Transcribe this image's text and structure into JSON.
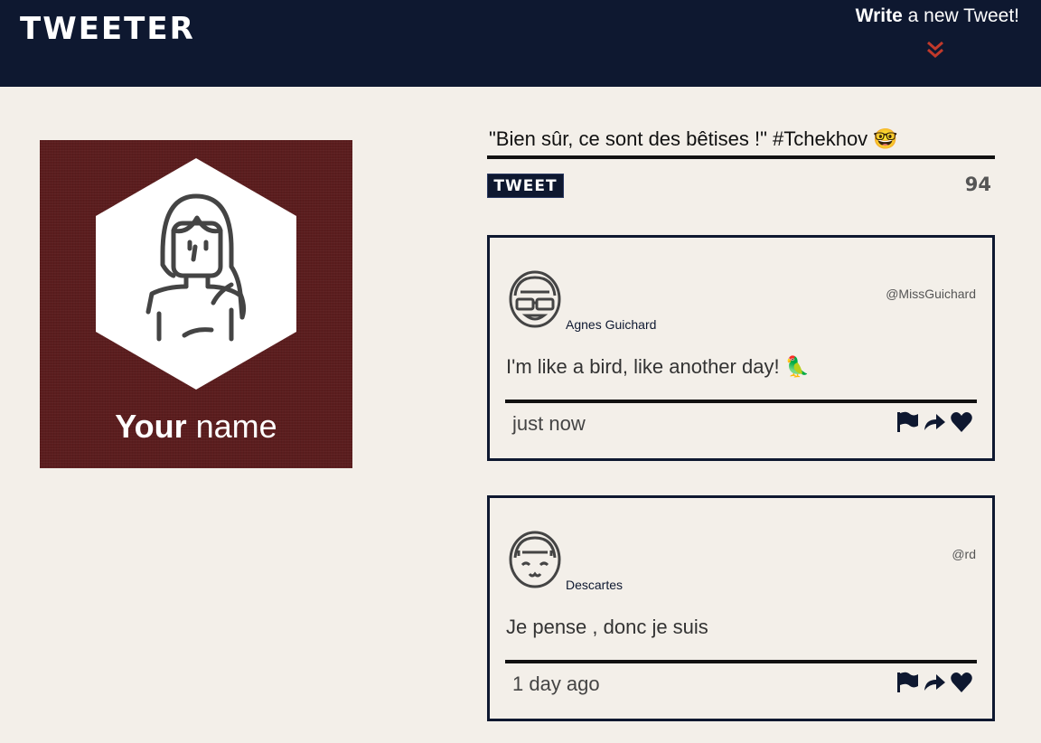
{
  "nav": {
    "brand": "TWEETER",
    "write_bold": "Write",
    "write_rest": " a new Tweet!",
    "chevron_icon": "double-chevron-down-icon",
    "chevron_color": "#c0392b"
  },
  "profile": {
    "name_bold": "Your",
    "name_rest": " name",
    "avatar_icon": "woman-avatar-icon",
    "background_color": "#5b1d1e"
  },
  "composer": {
    "value": "\"Bien sûr, ce sont des bêtises !\" #Tchekhov 🤓",
    "button_label": "TWEET",
    "counter": "94"
  },
  "tweets": [
    {
      "avatar_icon": "girl-glasses-avatar-icon",
      "name": "Agnes Guichard",
      "handle": "@MissGuichard",
      "body": "I'm like a bird, like another day! 🦜",
      "time": "just now",
      "actions": [
        "flag-icon",
        "retweet-icon",
        "heart-icon"
      ]
    },
    {
      "avatar_icon": "girl-smile-avatar-icon",
      "name": "Descartes",
      "handle": "@rd",
      "body": "Je pense , donc je suis",
      "time": "1 day ago",
      "actions": [
        "flag-icon",
        "retweet-icon",
        "heart-icon"
      ]
    }
  ],
  "colors": {
    "navy": "#0e1830",
    "page_bg": "#f3efe9"
  }
}
